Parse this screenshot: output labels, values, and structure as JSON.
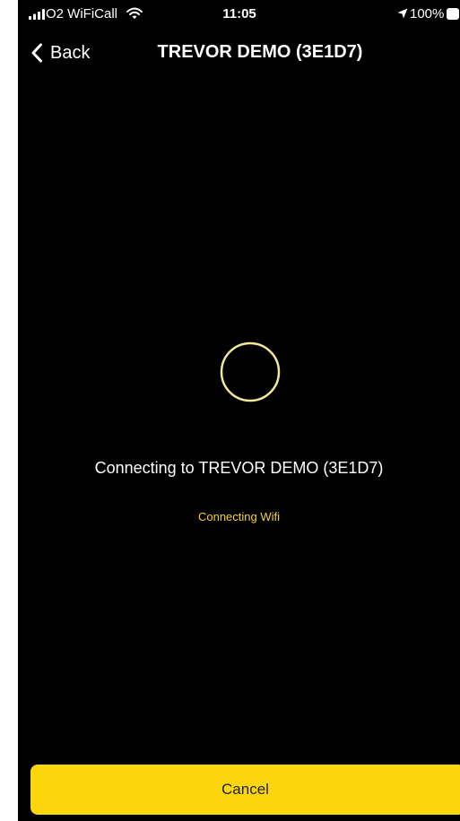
{
  "status_bar": {
    "carrier": "O2 WiFiCall",
    "time": "11:05",
    "battery_percent": "100%",
    "icons": [
      "signal-bars-icon",
      "wifi-icon",
      "location-arrow-icon",
      "battery-icon"
    ]
  },
  "nav": {
    "back_label": "Back",
    "title": "TREVOR DEMO (3E1D7)"
  },
  "main": {
    "connecting_title": "Connecting to TREVOR DEMO (3E1D7)",
    "connecting_status": "Connecting Wifi"
  },
  "footer": {
    "cancel_label": "Cancel"
  },
  "colors": {
    "background": "#000000",
    "accent": "#fcd60c",
    "status_text": "#f3d23b",
    "spinner": "#f3e79a"
  }
}
